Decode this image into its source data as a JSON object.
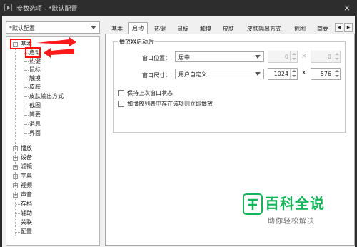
{
  "window": {
    "title": "参数选项 - *默认配置",
    "close_glyph": "×"
  },
  "preset": {
    "value": "*默认配置"
  },
  "tree": {
    "root": "基本",
    "root_toggle": "-",
    "children": [
      "启动",
      "热键",
      "鼠标",
      "触摸",
      "皮肤",
      "皮肤输出方式",
      "截图",
      "简要",
      "消息",
      "界面"
    ],
    "groups": [
      {
        "toggle": "+",
        "label": "播放"
      },
      {
        "toggle": "+",
        "label": "设备"
      },
      {
        "toggle": "+",
        "label": "滤镜"
      },
      {
        "toggle": "+",
        "label": "字幕"
      },
      {
        "toggle": "+",
        "label": "视频"
      },
      {
        "toggle": "+",
        "label": "声音"
      }
    ],
    "tail": [
      "存档",
      "辅助",
      "关联",
      "配置"
    ]
  },
  "tabs": {
    "items": [
      "基本",
      "启动",
      "热键",
      "鼠标",
      "触摸",
      "皮肤",
      "皮肤输出方式",
      "截图",
      "简要"
    ],
    "active": "启动",
    "scroll_left": "◀",
    "scroll_right": "▶"
  },
  "startup": {
    "group_title": "播放器启动后",
    "window_position": {
      "label": "窗口位置：",
      "value": "居中",
      "x": "0",
      "y": "0"
    },
    "window_size": {
      "label": "窗口尺寸：",
      "value": "用户自定义",
      "width": "1024",
      "height": "576"
    },
    "times_disabled": "×",
    "times": "x",
    "remember_state": "保持上次窗口状态",
    "play_if_exists": "如播放列表中存在该项则立即播放"
  },
  "watermark": {
    "title": "百科全说",
    "subtitle": "助你轻松解决"
  },
  "colors": {
    "highlight": "#ff1a1a",
    "watermark_green": "#16b35a"
  }
}
